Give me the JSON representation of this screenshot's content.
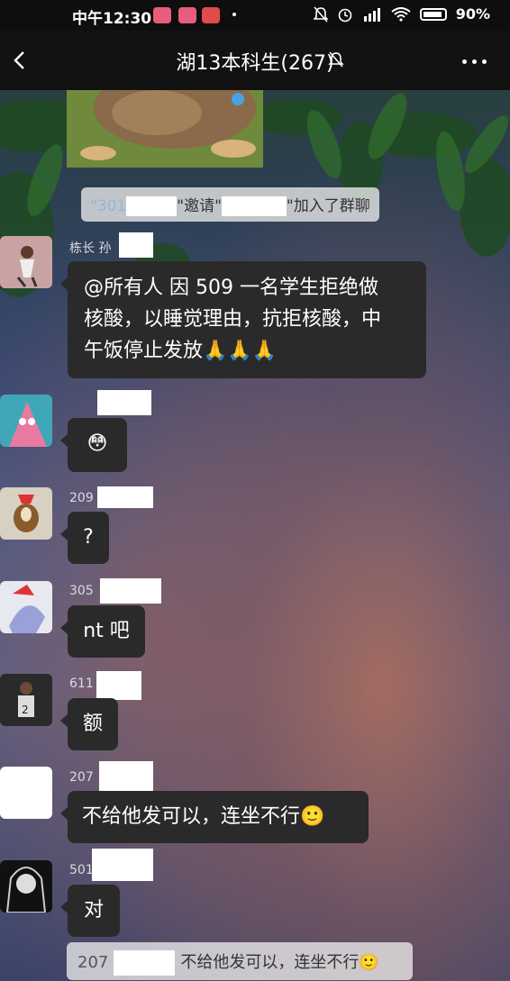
{
  "status_bar": {
    "time": "中午12:30",
    "battery": "90%"
  },
  "header": {
    "title": "湖13本科生(267)"
  },
  "system_messages": [
    {
      "prefix": "\"301",
      "middle": "\"邀请\"",
      "suffix": "\"加入了群聊"
    },
    {
      "prefix": "207",
      "text": "不给他发可以，连坐不行🙂"
    }
  ],
  "messages": [
    {
      "sender": "栋长 孙",
      "text": "@所有人  因 509 一名学生拒绝做核酸，以睡觉理由，抗拒核酸，中午饭停止发放🙏🙏🙏",
      "lines": [
        "@所有人  因 509 一名学生拒绝做",
        "核酸，以睡觉理由，抗拒核酸，中",
        "午饭停止发放🙏🙏🙏"
      ]
    },
    {
      "sender": "",
      "text": "😳"
    },
    {
      "sender": "209",
      "text": "?"
    },
    {
      "sender": "305",
      "text": "nt 吧"
    },
    {
      "sender": "611",
      "text": "额"
    },
    {
      "sender": "207",
      "text": "不给他发可以，连坐不行🙂"
    },
    {
      "sender": "501",
      "text": "对"
    }
  ],
  "colors": {
    "bubble": "#2a2a2a",
    "navbar": "#121212",
    "system_pill": "#ebebeb"
  },
  "icons": {
    "back": "back-arrow-icon",
    "mute": "mute-bell-icon",
    "more": "more-dots-icon"
  }
}
